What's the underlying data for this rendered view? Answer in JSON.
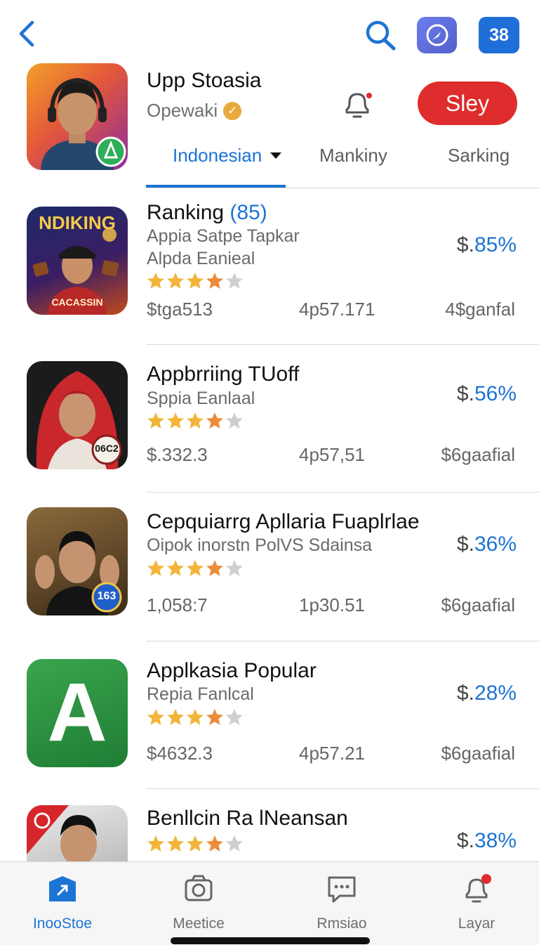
{
  "top_bar": {
    "back_icon": "chevron-left-icon",
    "search_icon": "search-icon",
    "compass_icon": "compass-icon",
    "badge_label": "38"
  },
  "header": {
    "title": "Upp Stoasia",
    "subtitle": "Opewaki",
    "get_label": "Sley",
    "accent": "#df2c2c"
  },
  "tabs": [
    {
      "label": "Indonesian",
      "active": true
    },
    {
      "label": "Mankiny",
      "active": false
    },
    {
      "label": "Sarking",
      "active": false
    }
  ],
  "apps": [
    {
      "title": "Ranking",
      "count": "(85)",
      "line1": "Appia Satpe Tapkar",
      "line2": "Alpda Eanieal",
      "rating": 3.5,
      "currency": "$.",
      "percent": "85%",
      "stat1": "$tga513",
      "stat2": "4p57.171",
      "stat3": "4$ganfal",
      "icon_banner": "NDIKING",
      "icon_caption": "CACASSIN"
    },
    {
      "title": "Appbrriing TUoff",
      "count": "",
      "line1": "Sppia Eanlaal",
      "line2": "",
      "rating": 3.5,
      "currency": "$.",
      "percent": "56%",
      "stat1": "$.332.3",
      "stat2": "4p57,51",
      "stat3": "$6gaafial",
      "icon_badge": "06C2"
    },
    {
      "title": "Cepquiarrg Apllaria Fuaplrlae",
      "count": "",
      "line1": "Oipok inorstn PolVS Sdainsa",
      "line2": "",
      "rating": 3.5,
      "currency": "$.",
      "percent": "36%",
      "stat1": "1,058:7",
      "stat2": "1p30.51",
      "stat3": "$6gaafial",
      "icon_badge": "163"
    },
    {
      "title": "Applkasia Popular",
      "count": "",
      "line1": "Repia Fanlcal",
      "line2": "",
      "rating": 3.5,
      "currency": "$.",
      "percent": "28%",
      "stat1": "$4632.3",
      "stat2": "4p57.21",
      "stat3": "$6gaafial",
      "icon_letter": "A"
    },
    {
      "title": "Benllcin Ra lNeansan",
      "count": "",
      "line1": "",
      "line2": "",
      "rating": 3.5,
      "currency": "$.",
      "percent": "38%",
      "stat1": "",
      "stat2": "",
      "stat3": ""
    }
  ],
  "bottom_nav": [
    {
      "label": "InooStoe",
      "icon": "store-icon",
      "active": true
    },
    {
      "label": "Meetice",
      "icon": "camera-icon",
      "active": false
    },
    {
      "label": "Rmsiao",
      "icon": "chat-icon",
      "active": false
    },
    {
      "label": "Layar",
      "icon": "notification-icon",
      "active": false
    }
  ]
}
